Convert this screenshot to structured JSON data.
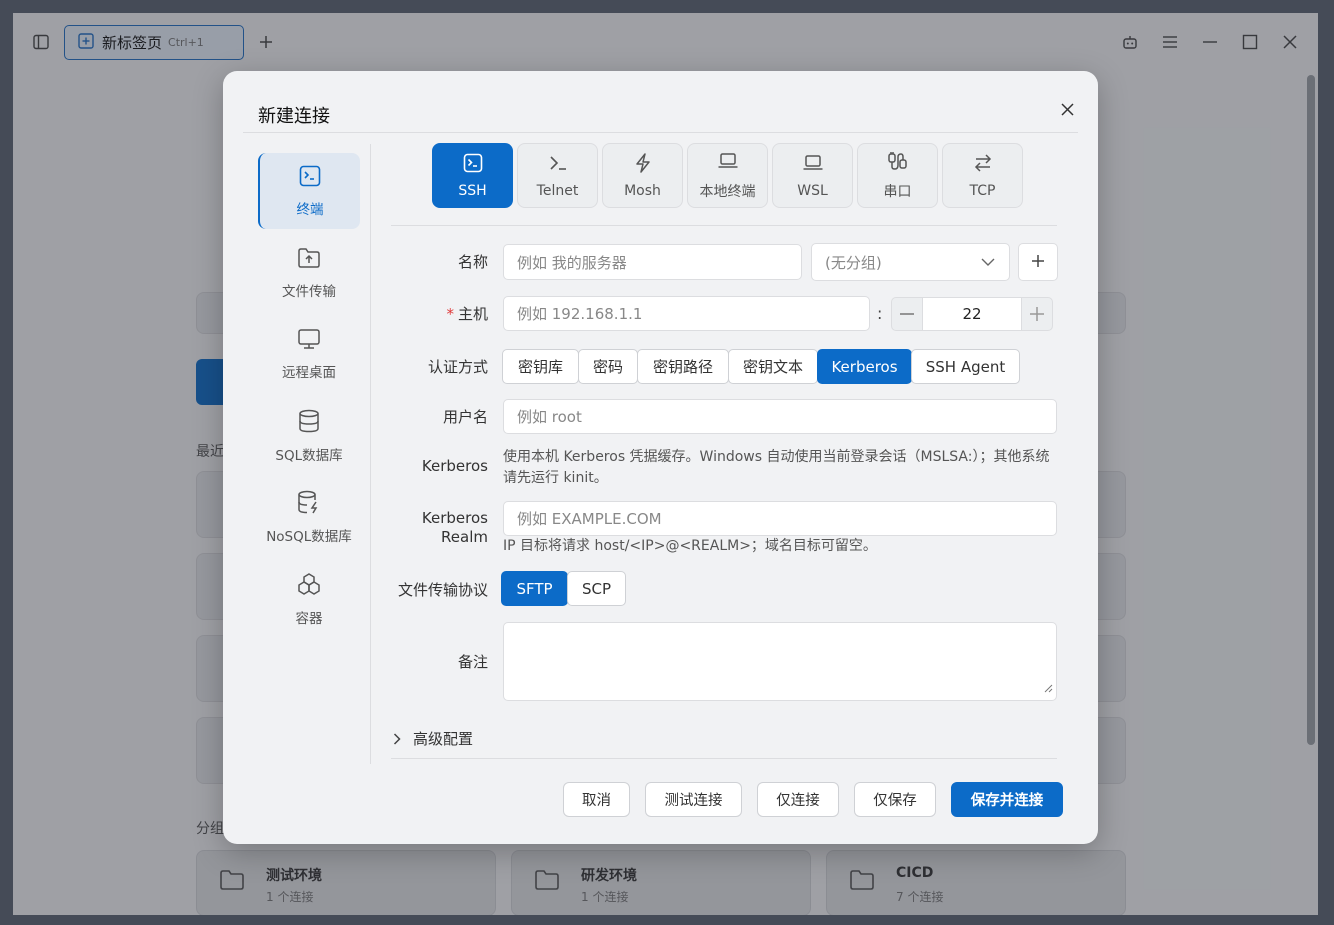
{
  "titlebar": {
    "tab_label": "新标签页",
    "tab_shortcut": "Ctrl+1"
  },
  "background": {
    "recent_label": "最近",
    "groups_label": "分组",
    "groups": [
      {
        "name": "测试环境",
        "count": "1 个连接"
      },
      {
        "name": "研发环境",
        "count": "1 个连接"
      },
      {
        "name": "CICD",
        "count": "7 个连接"
      }
    ]
  },
  "modal": {
    "title": "新建连接",
    "sidebar": [
      {
        "label": "终端",
        "icon": "terminal-icon",
        "active": true
      },
      {
        "label": "文件传输",
        "icon": "folder-upload-icon"
      },
      {
        "label": "远程桌面",
        "icon": "monitor-icon"
      },
      {
        "label": "SQL数据库",
        "icon": "database-icon"
      },
      {
        "label": "NoSQL数据库",
        "icon": "nosql-database-icon"
      },
      {
        "label": "容器",
        "icon": "container-icon"
      }
    ],
    "protocols": [
      {
        "label": "SSH",
        "icon": "ssh-icon",
        "active": true
      },
      {
        "label": "Telnet",
        "icon": "prompt-icon"
      },
      {
        "label": "Mosh",
        "icon": "lightning-icon"
      },
      {
        "label": "本地终端",
        "icon": "laptop-icon"
      },
      {
        "label": "WSL",
        "icon": "laptop-icon"
      },
      {
        "label": "串口",
        "icon": "serial-plug-icon"
      },
      {
        "label": "TCP",
        "icon": "arrows-swap-icon"
      }
    ],
    "form": {
      "name_label": "名称",
      "name_placeholder": "例如 我的服务器",
      "group_value": "(无分组)",
      "host_required": "*",
      "host_label": "主机",
      "host_placeholder": "例如 192.168.1.1",
      "port_colon": ":",
      "port_value": "22",
      "auth_label": "认证方式",
      "auth_options": [
        "密钥库",
        "密码",
        "密钥路径",
        "密钥文本",
        "Kerberos",
        "SSH Agent"
      ],
      "auth_selected": "Kerberos",
      "username_label": "用户名",
      "username_placeholder": "例如 root",
      "kerberos_label": "Kerberos",
      "kerberos_hint": "使用本机 Kerberos 凭据缓存。Windows 自动使用当前登录会话（MSLSA:）；其他系统请先运行 kinit。",
      "realm_label_1": "Kerberos",
      "realm_label_2": "Realm",
      "realm_placeholder": "例如 EXAMPLE.COM",
      "realm_hint": "IP 目标将请求 host/<IP>@<REALM>；域名目标可留空。",
      "file_protocol_label": "文件传输协议",
      "file_protocol_options": [
        "SFTP",
        "SCP"
      ],
      "file_protocol_selected": "SFTP",
      "notes_label": "备注",
      "advanced_label": "高级配置"
    },
    "footer": {
      "cancel": "取消",
      "test": "测试连接",
      "connect_only": "仅连接",
      "save_only": "仅保存",
      "save_connect": "保存并连接"
    }
  },
  "colors": {
    "accent": "#0c6bc8",
    "required": "#e03b3b"
  }
}
